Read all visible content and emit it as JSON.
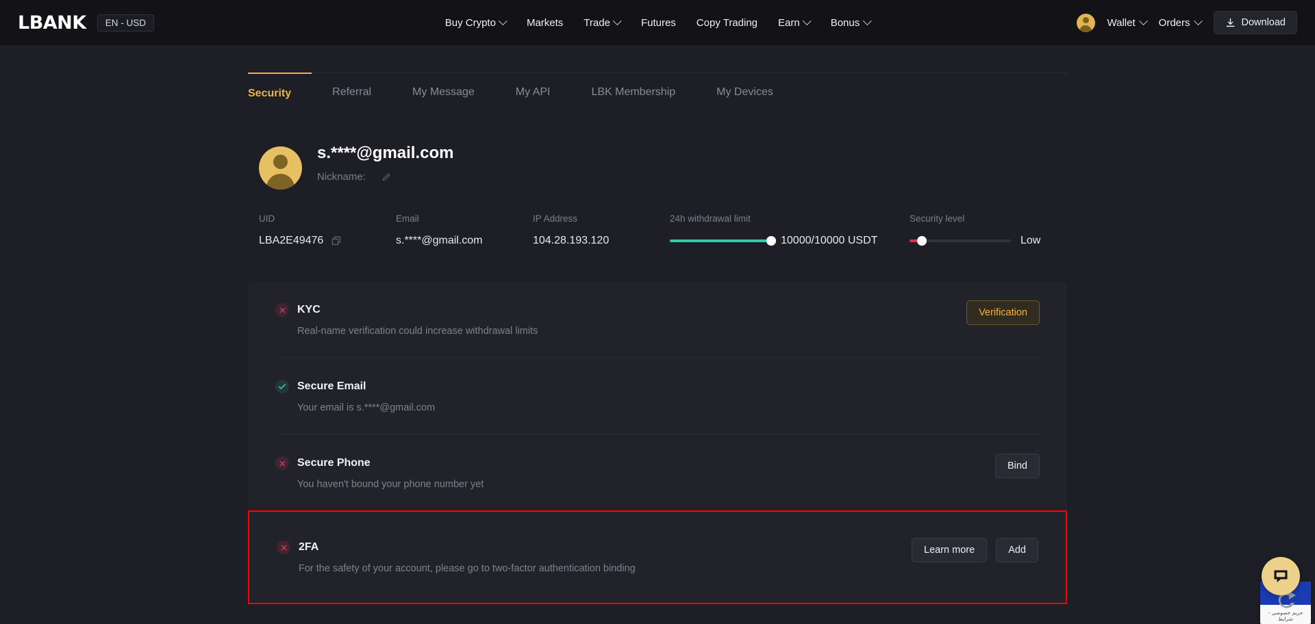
{
  "header": {
    "logo": "LBANK",
    "lang": "EN - USD",
    "nav": [
      {
        "label": "Buy Crypto",
        "caret": true
      },
      {
        "label": "Markets",
        "caret": false
      },
      {
        "label": "Trade",
        "caret": true
      },
      {
        "label": "Futures",
        "caret": false
      },
      {
        "label": "Copy Trading",
        "caret": false
      },
      {
        "label": "Earn",
        "caret": true
      },
      {
        "label": "Bonus",
        "caret": true
      }
    ],
    "wallet": "Wallet",
    "orders": "Orders",
    "download": "Download"
  },
  "tabs": [
    {
      "label": "Security",
      "active": true
    },
    {
      "label": "Referral",
      "active": false
    },
    {
      "label": "My Message",
      "active": false
    },
    {
      "label": "My API",
      "active": false
    },
    {
      "label": "LBK Membership",
      "active": false
    },
    {
      "label": "My Devices",
      "active": false
    }
  ],
  "profile": {
    "email": "s.****@gmail.com",
    "nickname_label": "Nickname:",
    "nickname_value": ""
  },
  "info": {
    "uid_label": "UID",
    "uid_value": "LBA2E49476",
    "email_label": "Email",
    "email_value": "s.****@gmail.com",
    "ip_label": "IP Address",
    "ip_value": "104.28.193.120",
    "withdrawal_label": "24h withdrawal limit",
    "withdrawal_value": "10000/10000 USDT",
    "withdrawal_percent": 100,
    "withdrawal_color": "#2dcea8",
    "security_label": "Security level",
    "security_value": "Low",
    "security_percent": 12,
    "security_color": "#e8294f"
  },
  "security_items": [
    {
      "title": "KYC",
      "desc": "Real-name verification could increase withdrawal limits",
      "status": "bad",
      "buttons": [
        {
          "label": "Verification",
          "style": "gold"
        }
      ],
      "highlight": false
    },
    {
      "title": "Secure Email",
      "desc": "Your email is s.****@gmail.com",
      "status": "good",
      "buttons": [],
      "highlight": false
    },
    {
      "title": "Secure Phone",
      "desc": "You haven't bound your phone number yet",
      "status": "bad",
      "buttons": [
        {
          "label": "Bind",
          "style": "plain"
        }
      ],
      "highlight": false
    },
    {
      "title": "2FA",
      "desc": "For the safety of your account, please go to two-factor authentication binding",
      "status": "bad",
      "buttons": [
        {
          "label": "Learn more",
          "style": "plain"
        },
        {
          "label": "Add",
          "style": "plain"
        }
      ],
      "highlight": true
    }
  ],
  "widget": {
    "recaptcha_text": "حريم خصوصی - شرايط"
  },
  "colors": {
    "accent_gold": "#f3b33d",
    "status_bad": "#e2345a",
    "status_good": "#2dcea8",
    "highlight_border": "#ff0000",
    "page_bg": "#1e1e26",
    "header_bg": "#121217",
    "card_bg": "#22222b"
  }
}
